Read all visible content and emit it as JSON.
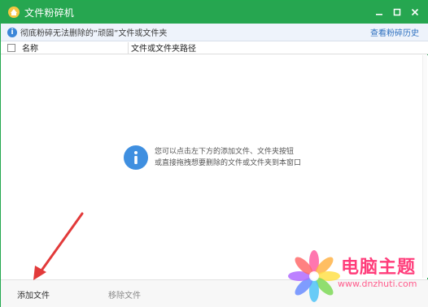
{
  "window": {
    "title": "文件粉碎机",
    "title_bar_color": "#26a650"
  },
  "info_bar": {
    "message": "彻底粉碎无法删除的“顽固”文件或文件夹",
    "history_link": "查看粉碎历史"
  },
  "table": {
    "columns": [
      "名称",
      "文件或文件夹路径"
    ]
  },
  "empty_state": {
    "line1": "您可以点击左下方的添加文件、文件夹按钮",
    "line2": "或直接拖拽想要删除的文件或文件夹到本窗口"
  },
  "footer": {
    "add_button": "添加文件",
    "remove_button": "移除文件"
  },
  "watermark": {
    "title": "电脑主题",
    "site": "www.dnzhuti.com"
  },
  "colors": {
    "accent_green": "#26a650",
    "info_blue": "#3f8fe0",
    "arrow_red": "#e23a3a",
    "watermark_pink": "#ff3c7a"
  }
}
